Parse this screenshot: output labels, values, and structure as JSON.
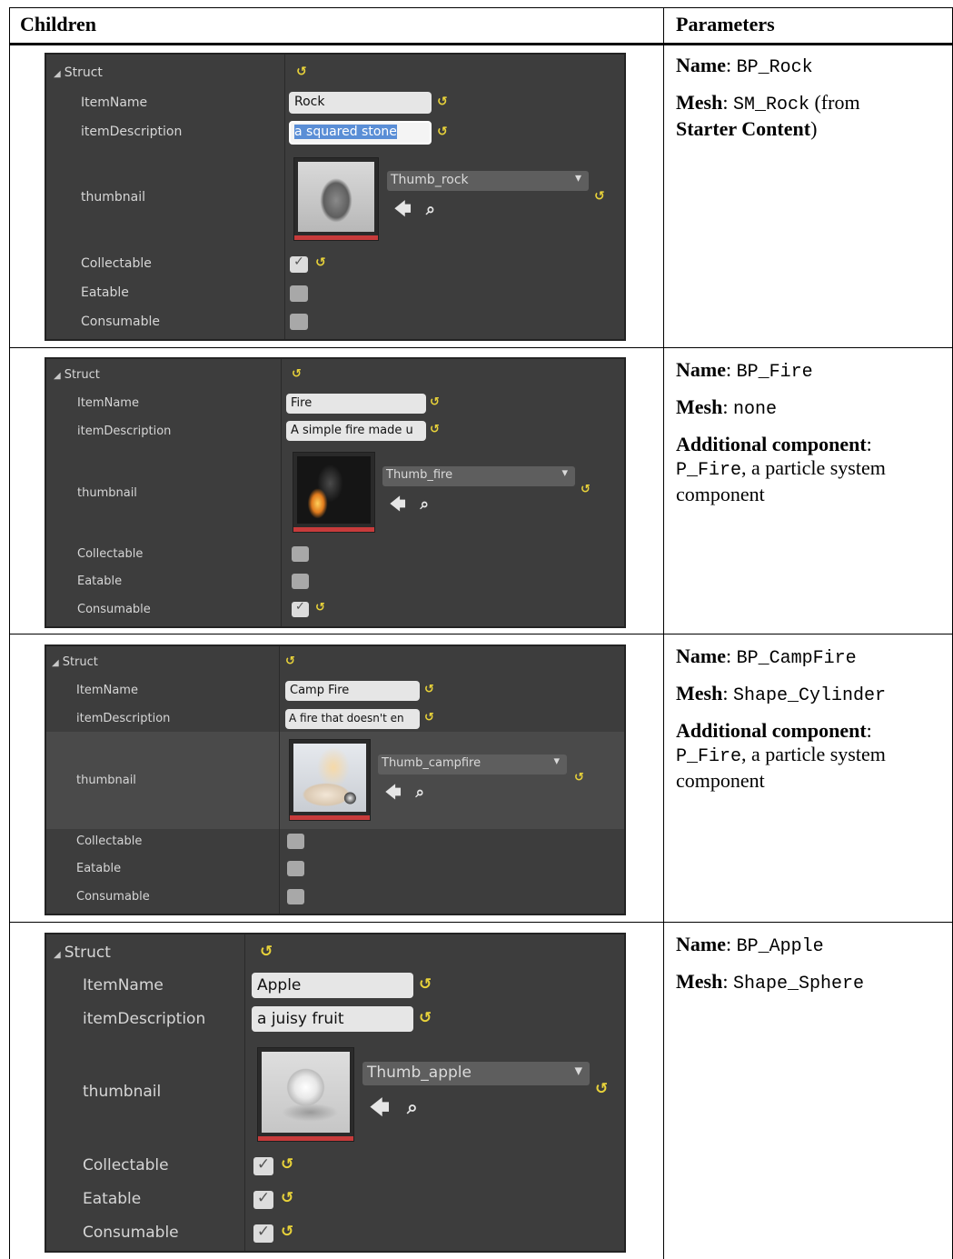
{
  "table": {
    "header_children": "Children",
    "header_parameters": "Parameters"
  },
  "rows": [
    {
      "panel": {
        "struct_label": "Struct",
        "item_name_label": "ItemName",
        "item_description_label": "itemDescription",
        "thumbnail_label": "thumbnail",
        "collectable_label": "Collectable",
        "eatable_label": "Eatable",
        "consumable_label": "Consumable",
        "item_name_value": "Rock",
        "item_description_value": "a squared stone",
        "thumbnail_asset": "Thumb_rock",
        "collectable": true,
        "eatable": false,
        "consumable": false
      },
      "params": {
        "name_label": "Name",
        "name_value": "BP_Rock",
        "mesh_label": "Mesh",
        "mesh_value": "SM_Rock",
        "mesh_suffix_pre": "(from",
        "mesh_suffix_bold": "Starter Content",
        "mesh_suffix_post": ")"
      }
    },
    {
      "panel": {
        "struct_label": "Struct",
        "item_name_label": "ItemName",
        "item_description_label": "itemDescription",
        "thumbnail_label": "thumbnail",
        "collectable_label": "Collectable",
        "eatable_label": "Eatable",
        "consumable_label": "Consumable",
        "item_name_value": "Fire",
        "item_description_value": "A simple fire made u",
        "thumbnail_asset": "Thumb_fire",
        "collectable": false,
        "eatable": false,
        "consumable": true
      },
      "params": {
        "name_label": "Name",
        "name_value": "BP_Fire",
        "mesh_label": "Mesh",
        "mesh_value": "none",
        "additional_label": "Additional component",
        "additional_value": "P_Fire",
        "additional_desc": ", a particle system component"
      }
    },
    {
      "panel": {
        "struct_label": "Struct",
        "item_name_label": "ItemName",
        "item_description_label": "itemDescription",
        "thumbnail_label": "thumbnail",
        "collectable_label": "Collectable",
        "eatable_label": "Eatable",
        "consumable_label": "Consumable",
        "item_name_value": "Camp Fire",
        "item_description_value": "A fire that doesn't en",
        "thumbnail_asset": "Thumb_campfire",
        "collectable": false,
        "eatable": false,
        "consumable": false
      },
      "params": {
        "name_label": "Name",
        "name_value": "BP_CampFire",
        "mesh_label": "Mesh",
        "mesh_value": "Shape_Cylinder",
        "additional_label": "Additional component",
        "additional_value": "P_Fire",
        "additional_desc": ", a particle system component"
      }
    },
    {
      "panel": {
        "struct_label": "Struct",
        "item_name_label": "ItemName",
        "item_description_label": "itemDescription",
        "thumbnail_label": "thumbnail",
        "collectable_label": "Collectable",
        "eatable_label": "Eatable",
        "consumable_label": "Consumable",
        "item_name_value": "Apple",
        "item_description_value": "a juisy fruit",
        "thumbnail_asset": "Thumb_apple",
        "collectable": true,
        "eatable": true,
        "consumable": true
      },
      "params": {
        "name_label": "Name",
        "name_value": "BP_Apple",
        "mesh_label": "Mesh",
        "mesh_value": "Shape_Sphere"
      }
    }
  ],
  "icons": {
    "reset": "reset-to-default-icon",
    "expand": "collapse-triangle-icon",
    "dropdown": "chevron-down-icon",
    "use_selected": "left-arrow-icon",
    "browse": "search-icon",
    "checkbox": "checkmark-icon"
  },
  "colors": {
    "panel_bg": "#3d3d3d",
    "reset_icon": "#e8d23a",
    "thumbnail_bar": "#c73b3b",
    "selection": "#5a8ed6"
  }
}
